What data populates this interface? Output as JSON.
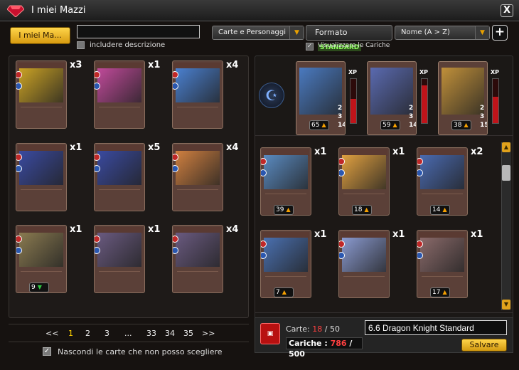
{
  "window": {
    "title": "I miei Mazzi",
    "close_label": "X"
  },
  "toolbar": {
    "my_decks_label": "I miei Ma...",
    "search_value": "",
    "include_description_label": "includere descrizione",
    "type_select_value": "Carte e Personaggi",
    "format_label": "Formato",
    "format_value": "STANDARD",
    "sort_select_value": "Nome (A > Z)",
    "plus_label": "+",
    "show_charges_label": "Visualizzare le Cariche",
    "show_charges_checked": true
  },
  "collection": {
    "cards": [
      {
        "name": "card-1",
        "qty": "x3",
        "color": "#caa224"
      },
      {
        "name": "card-2",
        "qty": "x1",
        "color": "#c04a9a"
      },
      {
        "name": "card-3",
        "qty": "x4",
        "color": "#4a80d0"
      },
      {
        "name": "card-4",
        "qty": "x1",
        "color": "#3a4aa0"
      },
      {
        "name": "card-5",
        "qty": "x5",
        "color": "#3a4aa0"
      },
      {
        "name": "card-6",
        "qty": "x4",
        "color": "#d08040"
      },
      {
        "name": "card-7",
        "qty": "x1",
        "color": "#8a7a50",
        "cost": "9",
        "cost_dir": "down"
      },
      {
        "name": "card-8",
        "qty": "x1",
        "color": "#6a5a80"
      },
      {
        "name": "card-9",
        "qty": "x4",
        "color": "#6a5a80"
      }
    ]
  },
  "pagination": {
    "prev": "<<",
    "pages": [
      "1",
      "2",
      "3",
      "...",
      "33",
      "34",
      "35"
    ],
    "current": "1",
    "next": ">>"
  },
  "hide_unavailable": {
    "label": "Nascondi le carte che non posso scegliere",
    "checked": true
  },
  "heroes": [
    {
      "name": "hero-1",
      "xp_label": "XP",
      "xp_fill": 0.55,
      "stat1": "2",
      "stat2": "3",
      "stat3": "14",
      "cost": "65",
      "color": "#4a7ac0"
    },
    {
      "name": "hero-2",
      "xp_label": "XP",
      "xp_fill": 0.85,
      "stat1": "2",
      "stat2": "3",
      "stat3": "14",
      "cost": "59",
      "color": "#5a6ab0"
    },
    {
      "name": "hero-3",
      "xp_label": "XP",
      "xp_fill": 0.6,
      "stat1": "2",
      "stat2": "3",
      "stat3": "15",
      "cost": "38",
      "color": "#c0903a"
    }
  ],
  "deck_cards": [
    {
      "name": "deck-card-1",
      "qty": "x1",
      "cost": "39",
      "color": "#5a8ac0"
    },
    {
      "name": "deck-card-2",
      "qty": "x1",
      "cost": "18",
      "color": "#e0a040"
    },
    {
      "name": "deck-card-3",
      "qty": "x2",
      "cost": "14",
      "color": "#4a6ab0"
    },
    {
      "name": "deck-card-4",
      "qty": "x1",
      "cost": "7",
      "color": "#4a70b0"
    },
    {
      "name": "deck-card-5",
      "qty": "x1",
      "cost": "",
      "color": "#8a9ad0"
    },
    {
      "name": "deck-card-6",
      "qty": "x1",
      "cost": "17",
      "color": "#8a6a6a"
    }
  ],
  "deck_summary": {
    "cards_label": "Carte:",
    "cards_current": "18",
    "cards_max": "50",
    "charges_label": "Cariche :",
    "charges_current": "786",
    "charges_max": "500",
    "deck_name": "6.6 Dragon Knight Standard",
    "save_label": "Salvare"
  }
}
